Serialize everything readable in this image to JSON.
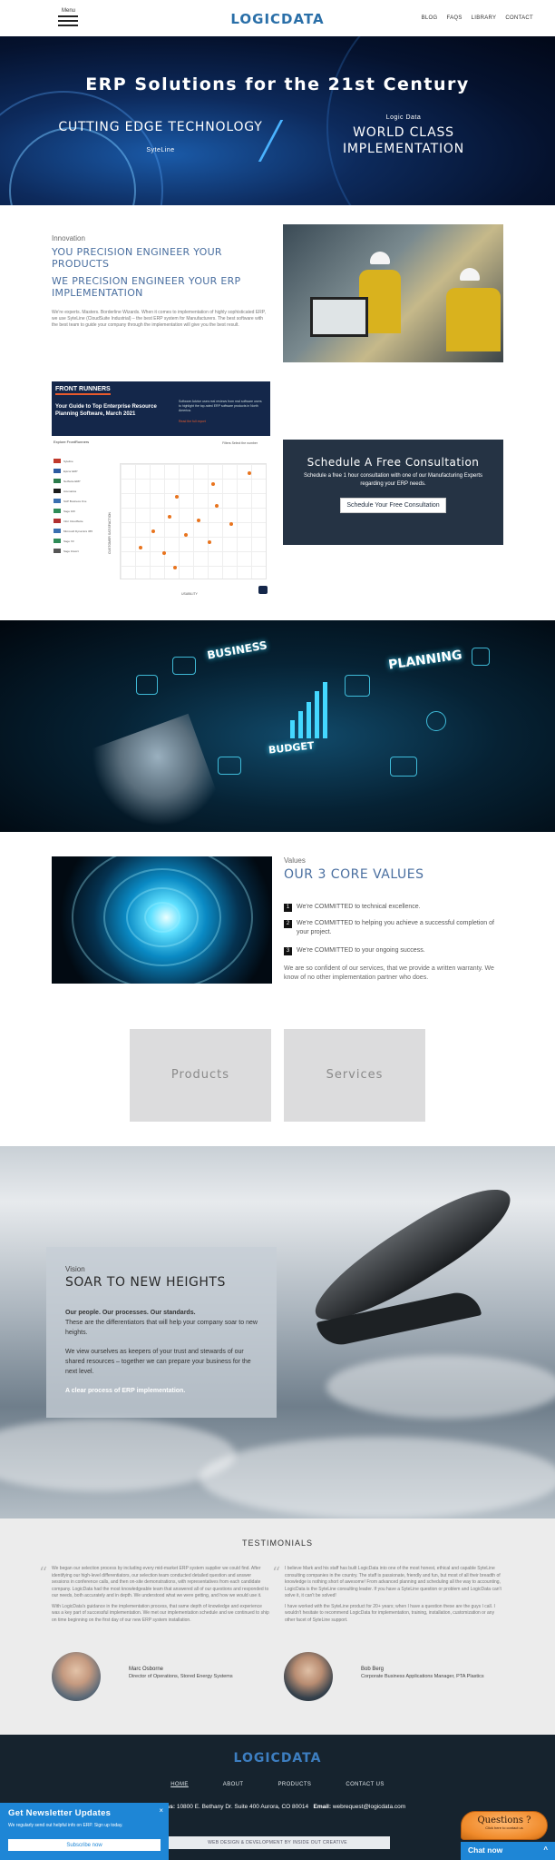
{
  "header": {
    "menu_label": "Menu",
    "logo_text": "LOGICDATA",
    "nav": [
      "BLOG",
      "FAQS",
      "LIBRARY",
      "CONTACT"
    ]
  },
  "hero": {
    "title": "ERP Solutions for the 21st Century",
    "left_big": "CUTTING EDGE TECHNOLOGY",
    "left_small": "SyteLine",
    "right_small": "Logic Data",
    "right_big": "WORLD CLASS IMPLEMENTATION"
  },
  "innovation": {
    "eyebrow": "Innovation",
    "heading1": "YOU PRECISION ENGINEER YOUR PRODUCTS",
    "heading2": "WE PRECISION ENGINEER YOUR ERP IMPLEMENTATION",
    "body": "We're experts. Masters. Borderline Wizards. When it comes to implementation of highly sophisticated ERP, we use SyteLine (CloudSuite Industrial) – the best ERP system for Manufacturers. The best software with the best team to guide your company through the implementation will give you the best result."
  },
  "front_runners": {
    "badge": "FRONT RUNNERS",
    "title": "Your Guide to Top Enterprise Resource Planning Software, March 2021",
    "desc": "Software Advice uses real reviews from real software users to highlight the top-rated ERP software products in North America.",
    "link": "Read the full report",
    "explore": "Explore FrontRunners",
    "filters": "Filters   Select the number",
    "vendors": [
      "Syteline",
      "Epicor ERP",
      "NetSuite ERP",
      "Acumatica",
      "SAP Business One",
      "Sage 100",
      "Infor CloudSuite",
      "Microsoft Dynamics 365",
      "Sage X3",
      "Sage Intacct"
    ],
    "y_axis": "CUSTOMER SATISFACTION",
    "x_axis": "USABILITY"
  },
  "consultation": {
    "title": "Schedule A Free Consultation",
    "body": "Schedule a free 1 hour consultation with one of our Manufacturing Experts regarding your ERP needs.",
    "button": "Schedule Your Free Consultation"
  },
  "planning_band": {
    "words": [
      "BUSINESS",
      "PLANNING",
      "BUDGET"
    ]
  },
  "core_values": {
    "eyebrow": "Values",
    "heading": "OUR 3 CORE VALUES",
    "items": [
      {
        "num": "1",
        "text": "We're COMMITTED to technical excellence."
      },
      {
        "num": "2",
        "text": "We're COMMITTED to helping you achieve a successful completion of your project."
      },
      {
        "num": "3",
        "text": "We're COMMITTED to your ongoing success."
      }
    ],
    "footer": "We are so confident of our services, that we provide a written warranty. We know of no other implementation partner who does."
  },
  "tiles": {
    "products": "Products",
    "services": "Services"
  },
  "vision": {
    "eyebrow": "Vision",
    "title": "SOAR TO NEW HEIGHTS",
    "bold": "Our people. Our processes. Our standards.",
    "p1": "These are the differentiators that will help your company soar to new heights.",
    "p2": "We view ourselves as keepers of your trust and stewards of our shared resources – together we can prepare your business for the next level.",
    "link": "A clear process of ERP implementation."
  },
  "testimonials": {
    "heading": "TESTIMONIALS",
    "left": {
      "p1": "We began our selection process by including every mid-market ERP system supplier we could find. After identifying our high-level differentiators, our selection team conducted detailed question and answer sessions in conference calls, and then on-site demonstrations, with representatives from each candidate company. LogicData had the most knowledgeable team that answered all of our questions and responded to our needs, both accurately and in depth. We understood what we were getting, and how we would use it.",
      "p2": "With LogicData's guidance in the implementation process, that same depth of knowledge and experience was a key part of successful implementation. We met our implementation schedule and we continued to ship on time beginning on the first day of our new ERP system installation.",
      "name": "Marc Osborne",
      "role": "Director of Operations, Stored Energy Systems"
    },
    "right": {
      "p1": "I believe Mark and his staff has built LogicData into one of the most honest, ethical and capable SyteLine consulting companies in the country. The staff is passionate, friendly and fun, but most of all their breadth of knowledge is nothing short of awesome! From advanced planning and scheduling all the way to accounting, LogicData is the SyteLine consulting leader. If you have a SyteLine question or problem and LogicData can't solve it, it can't be solved!",
      "p2": "I have worked with the SyteLine product for 20+ years; when I have a question these are the guys I call. I wouldn't hesitate to recommend LogicData for implementation, training, installation, customization or any other facet of SyteLine support.",
      "name": "Bob Berg",
      "role": "Corporate Business Applications Manager, PTA Plastics"
    }
  },
  "footer": {
    "logo_text": "LOGICDATA",
    "nav": [
      "HOME",
      "ABOUT",
      "PRODUCTS",
      "CONTACT US"
    ],
    "address_label": "Address:",
    "address": "10800 E. Bethany Dr. Suite 400 Aurora, CO 80014",
    "email_label": "Email:",
    "email": "webrequest@logicdata.com",
    "credit": "WEB DESIGN & DEVELOPMENT BY INSIDE OUT CREATIVE"
  },
  "newsletter": {
    "title": "Get Newsletter Updates",
    "close": "×",
    "desc": "We regularly send out helpful info on ERP. Sign up today.",
    "button": "Subscribe now"
  },
  "chat": {
    "questions": "Questions ?",
    "sub": "Click here to contact us",
    "chat_now": "Chat now",
    "chevron": "^"
  },
  "colors": {
    "brand_blue": "#2a6fa8",
    "heading_blue": "#4a6fa0",
    "consult_bg": "#253344",
    "footer_bg": "#16232e",
    "newsletter_bg": "#1e86d6",
    "chat_orange": "#f08a2a"
  }
}
